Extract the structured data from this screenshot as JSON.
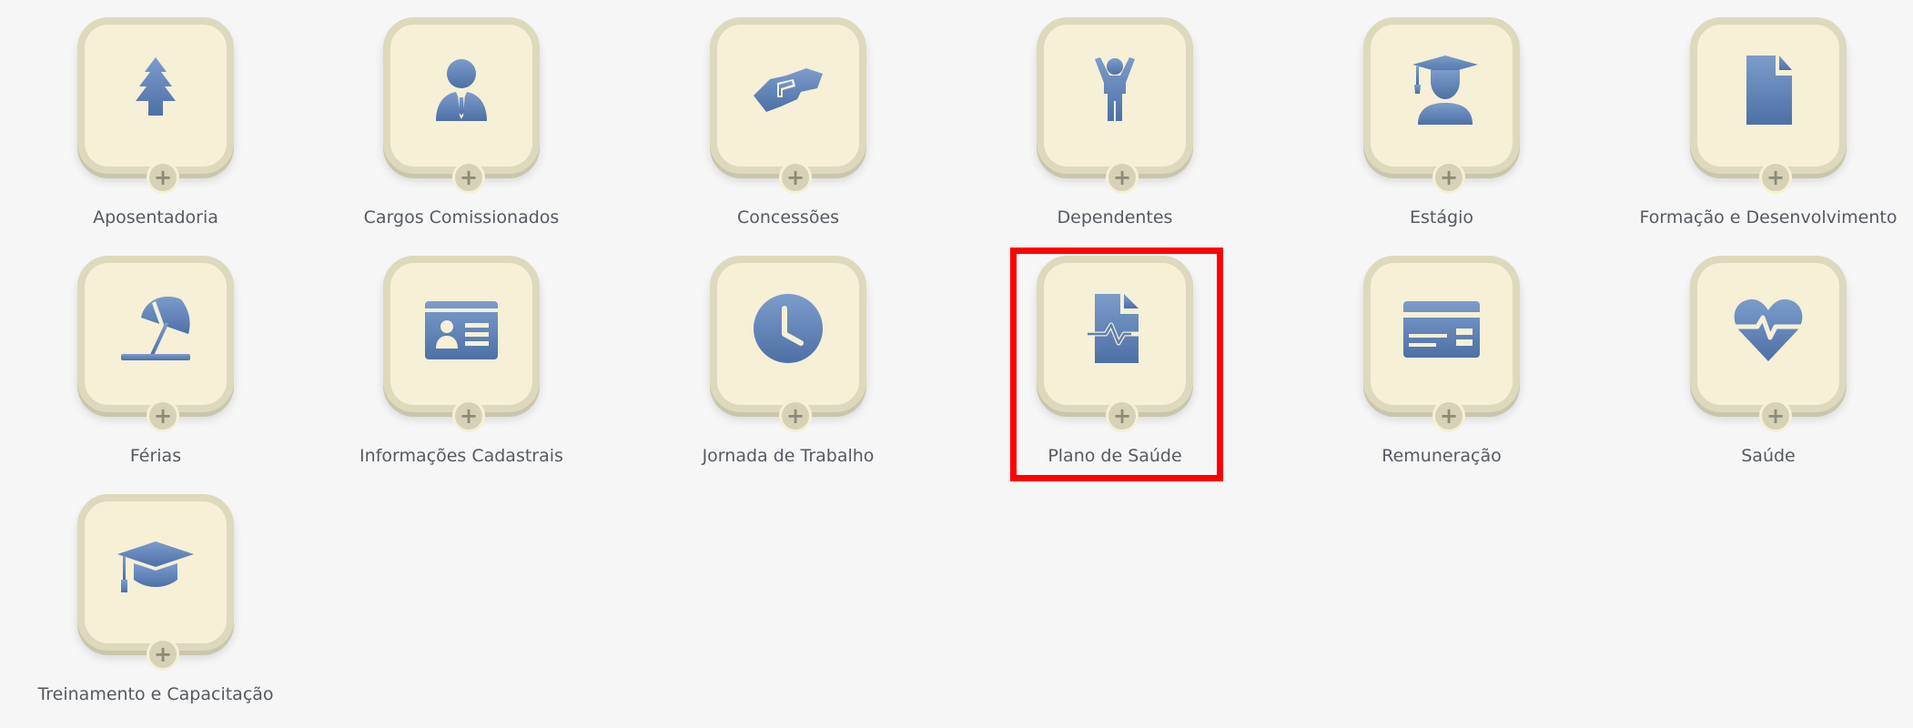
{
  "colors": {
    "background": "#f6f6f6",
    "tile_face": "#f5f0d6",
    "tile_border": "#ddd9bd",
    "icon": "#5b7fb3",
    "label": "#555a61",
    "highlight": "#ff0000"
  },
  "plus_symbol": "+",
  "tiles": [
    {
      "label": "Aposentadoria",
      "icon": "tree-icon"
    },
    {
      "label": "Cargos Comissionados",
      "icon": "businessman-icon"
    },
    {
      "label": "Concessões",
      "icon": "handshake-icon"
    },
    {
      "label": "Dependentes",
      "icon": "child-icon"
    },
    {
      "label": "Estágio",
      "icon": "graduate-student-icon"
    },
    {
      "label": "Formação e Desenvolvimento",
      "icon": "document-icon"
    },
    {
      "label": "Férias",
      "icon": "beach-umbrella-icon"
    },
    {
      "label": "Informações Cadastrais",
      "icon": "id-card-icon"
    },
    {
      "label": "Jornada de Trabalho",
      "icon": "clock-icon"
    },
    {
      "label": "Plano de Saúde",
      "icon": "medical-file-icon",
      "highlighted": true
    },
    {
      "label": "Remuneração",
      "icon": "payment-card-icon"
    },
    {
      "label": "Saúde",
      "icon": "heartbeat-icon"
    },
    {
      "label": "Treinamento e Capacitação",
      "icon": "graduation-cap-icon"
    }
  ]
}
